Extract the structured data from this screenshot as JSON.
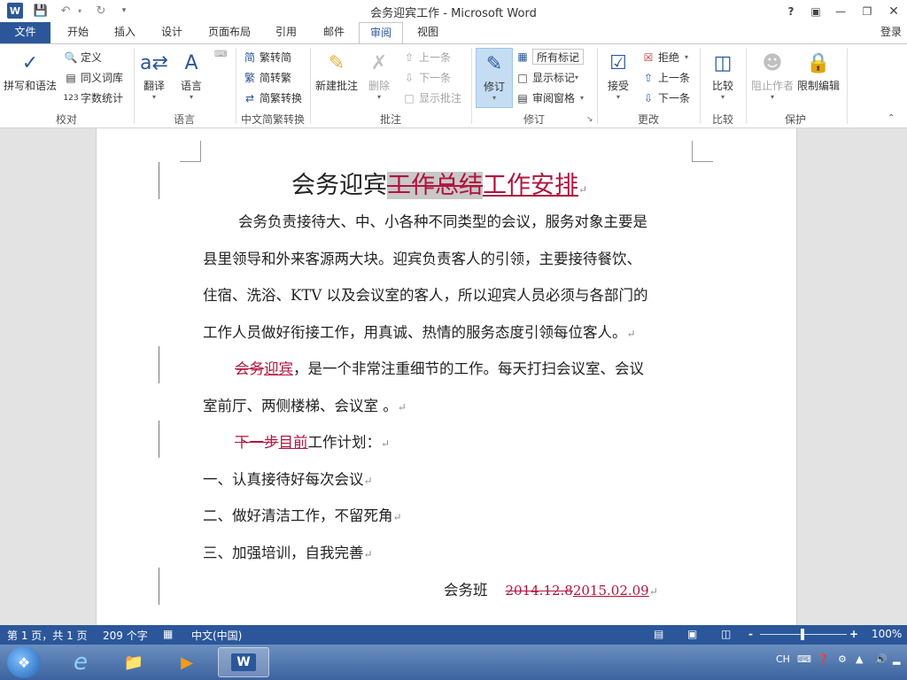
{
  "window": {
    "title": "会务迎宾工作 - Microsoft Word",
    "help": "?",
    "login": "登录"
  },
  "tabs": [
    "文件",
    "开始",
    "插入",
    "设计",
    "页面布局",
    "引用",
    "邮件",
    "审阅",
    "视图"
  ],
  "ribbon": {
    "proofing": {
      "label": "校对",
      "spelling": "拼写和语法",
      "define": "定义",
      "thesaurus": "同义词库",
      "wordcount": "字数统计"
    },
    "language": {
      "label": "语言",
      "translate": "翻译",
      "language": "语言"
    },
    "chinese": {
      "label": "中文简繁转换",
      "to_simplified": "繁转简",
      "to_traditional": "简转繁",
      "convert": "简繁转换"
    },
    "comments": {
      "label": "批注",
      "new": "新建批注",
      "delete": "删除",
      "prev": "上一条",
      "next": "下一条",
      "show": "显示批注"
    },
    "tracking": {
      "label": "修订",
      "track": "修订",
      "markup": "所有标记",
      "show_markup": "显示标记",
      "pane": "审阅窗格"
    },
    "changes": {
      "label": "更改",
      "accept": "接受",
      "reject": "拒绝",
      "prev": "上一条",
      "next": "下一条"
    },
    "compare": {
      "label": "比较",
      "compare": "比较"
    },
    "protect": {
      "label": "保护",
      "block": "阻止作者",
      "restrict": "限制编辑"
    }
  },
  "document": {
    "title_plain": "会务迎宾",
    "title_deleted": "工作总结",
    "title_inserted": "工作安排",
    "p1_lines": [
      "会务负责接待大、中、小各种不同类型的会议，服务对象主要是",
      "县里领导和外来客源两大块。迎宾负责客人的引领，主要接待餐饮、",
      "住宿、洗浴、KTV 以及会议室的客人，所以迎宾人员必须与各部门的",
      "工作人员做好衔接工作，用真诚、热情的服务态度引领每位客人。"
    ],
    "p2_deleted": "会务",
    "p2_inserted": "迎宾",
    "p2_rest": "，是一个非常注重细节的工作。每天打扫会议室、会议",
    "p2_line2": "室前厅、两侧楼梯、会议室 。",
    "p3_deleted": "下一步",
    "p3_inserted": "目前",
    "p3_rest": "工作计划：",
    "items": [
      "一、认真接待好每次会议",
      "二、做好清洁工作，不留死角",
      "三、加强培训，自我完善"
    ],
    "sign_name": "会务班",
    "sign_date_deleted": "2014.12.8",
    "sign_date_inserted": "2015.02.09"
  },
  "status": {
    "page": "第 1 页，共 1 页",
    "words": "209 个字",
    "lang": "中文(中国)",
    "zoom": "100%",
    "zoom_minus": "-",
    "zoom_plus": "+"
  },
  "tray": {
    "ime": "CH"
  },
  "colors": {
    "accent": "#2b579a",
    "revision": "#b0153e"
  }
}
